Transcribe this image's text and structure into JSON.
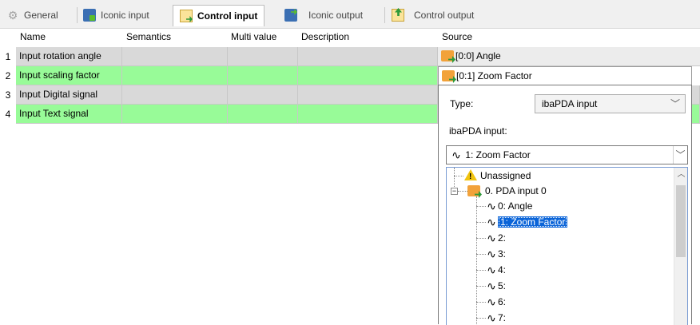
{
  "tabs": [
    {
      "label": "General",
      "icon": "gear-icon"
    },
    {
      "label": "Iconic input",
      "icon": "iconic-input-icon"
    },
    {
      "label": "Control input",
      "icon": "control-input-icon",
      "active": true
    },
    {
      "label": "Iconic output",
      "icon": "iconic-output-icon"
    },
    {
      "label": "Control output",
      "icon": "control-output-icon"
    }
  ],
  "columns": [
    "Name",
    "Semantics",
    "Multi value",
    "Description",
    "Source"
  ],
  "rows": [
    {
      "num": "1",
      "name": "Input rotation angle",
      "source": "[0:0] Angle"
    },
    {
      "num": "2",
      "name": "Input scaling factor",
      "source": "[0:1] Zoom Factor"
    },
    {
      "num": "3",
      "name": "Input Digital signal",
      "source": ""
    },
    {
      "num": "4",
      "name": "Input Text signal",
      "source": ""
    }
  ],
  "panel": {
    "type_label": "Type:",
    "type_value": "ibaPDA input",
    "input_label": "ibaPDA input:",
    "input_value": "1: Zoom Factor",
    "tree": {
      "unassigned": "Unassigned",
      "group": "0. PDA input 0",
      "items": [
        "0: Angle",
        "1: Zoom Factor",
        "2:",
        "3:",
        "4:",
        "5:",
        "6:",
        "7:"
      ],
      "selected_index": 1
    }
  },
  "colors": {
    "row_green": "#98fb98",
    "row_gray": "#d9d9d9",
    "selection": "#0a64d8"
  }
}
